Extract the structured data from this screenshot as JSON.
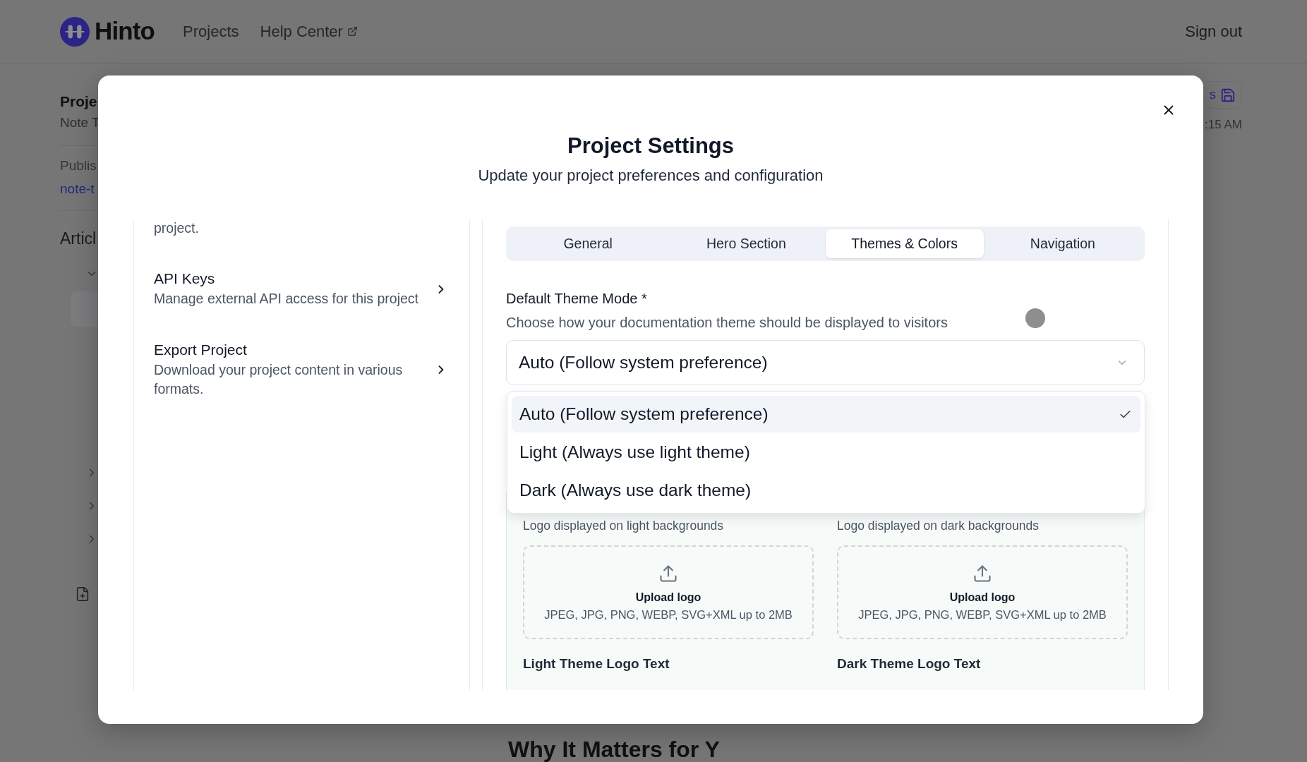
{
  "header": {
    "brand": "Hinto",
    "nav": [
      {
        "label": "Projects",
        "external": false
      },
      {
        "label": "Help Center",
        "external": true
      }
    ],
    "sign_out": "Sign out"
  },
  "background_page": {
    "project_title": "Proje",
    "project_subtitle": "Note T",
    "published_label": "Publis",
    "published_link": "note-t",
    "articles_heading": "Articl",
    "article_tree": [
      {
        "expanded": true
      },
      {
        "expanded": false
      },
      {
        "expanded": false
      },
      {
        "expanded": false
      }
    ],
    "save_button": {
      "label": "s"
    },
    "last_saved": ":15 AM",
    "section_heading": "Why It Matters for Y"
  },
  "settings_dialog": {
    "title": "Project Settings",
    "subtitle": "Update your project preferences and configuration",
    "menu_scrolled_text": "project.",
    "menu": [
      {
        "title": "API Keys",
        "description": "Manage external API access for this project"
      },
      {
        "title": "Export Project",
        "description": "Download your project content in various formats."
      }
    ],
    "tabs": [
      {
        "label": "General",
        "selected": false
      },
      {
        "label": "Hero Section",
        "selected": false
      },
      {
        "label": "Themes & Colors",
        "selected": true
      },
      {
        "label": "Navigation",
        "selected": false
      }
    ],
    "theme_mode": {
      "label": "Default Theme Mode *",
      "description": "Choose how your documentation theme should be displayed to visitors",
      "value": "Auto (Follow system preference)",
      "expanded": true,
      "options": [
        {
          "label": "Auto (Follow system preference)",
          "selected": true
        },
        {
          "label": "Light (Always use light theme)",
          "selected": false
        },
        {
          "label": "Dark (Always use dark theme)",
          "selected": false
        }
      ]
    },
    "logos": [
      {
        "caption": "Logo displayed on light backgrounds",
        "upload_label": "Upload logo",
        "upload_hint": "JPEG, JPG, PNG, WEBP, SVG+XML up to 2MB",
        "text_field_label": "Light Theme Logo Text"
      },
      {
        "caption": "Logo displayed on dark backgrounds",
        "upload_label": "Upload logo",
        "upload_hint": "JPEG, JPG, PNG, WEBP, SVG+XML up to 2MB",
        "text_field_label": "Dark Theme Logo Text"
      }
    ]
  }
}
